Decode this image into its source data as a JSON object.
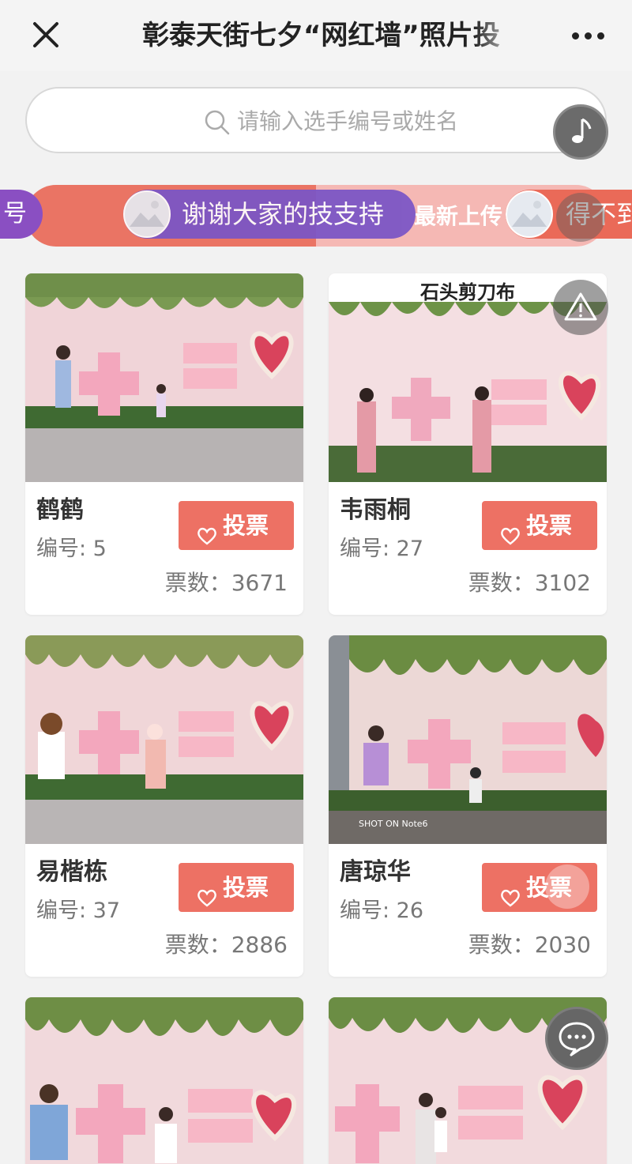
{
  "header": {
    "title": "彰泰天街七夕“网红墙”照片投",
    "close_icon": "close-icon",
    "more_icon": "more-dots-icon"
  },
  "search": {
    "placeholder": "请输入选手编号或姓名"
  },
  "marquee": {
    "left_fragment": "号",
    "message": "谢谢大家的技支持",
    "latest_label": "最新上传",
    "right_fragment": "得不到"
  },
  "vote_label": "投票",
  "cards": [
    {
      "name": "鹤鹤",
      "number": "编号: 5",
      "votes": "票数：3671"
    },
    {
      "name": "韦雨桐",
      "number": "编号: 27",
      "votes": "票数：3102",
      "photo_caption": "石头剪刀布"
    },
    {
      "name": "易楷栋",
      "number": "编号: 37",
      "votes": "票数：2886"
    },
    {
      "name": "唐琼华",
      "number": "编号: 26",
      "votes": "票数：2030",
      "photo_caption": "SHOT ON Note6"
    },
    {
      "name": "",
      "number": "",
      "votes": ""
    },
    {
      "name": "",
      "number": "",
      "votes": ""
    }
  ],
  "colors": {
    "accent": "#ed7164",
    "marquee_purple": "#7a55c6",
    "background": "#f2f2f2"
  }
}
